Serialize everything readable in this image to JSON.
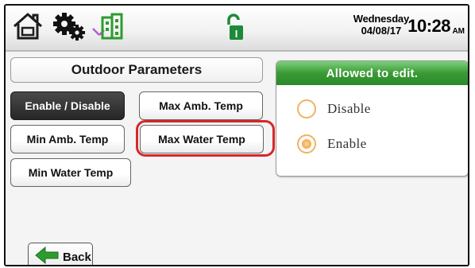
{
  "header": {
    "icons": [
      "home-icon",
      "settings-gears-icon",
      "building-network-icon",
      "unlocked-padlock-icon"
    ],
    "weekday": "Wednesday",
    "date": "04/08/17",
    "time": "10:28",
    "ampm": "AM"
  },
  "outdoor_parameters": {
    "title": "Outdoor Parameters",
    "buttons": [
      {
        "label": "Enable / Disable",
        "active": true
      },
      {
        "label": "Max Amb. Temp",
        "active": false
      },
      {
        "label": "Min Amb. Temp",
        "active": false
      },
      {
        "label": "Max Water Temp",
        "active": false,
        "highlighted": true
      },
      {
        "label": "Min Water Temp",
        "active": false
      }
    ],
    "highlight_color": "#d9262a"
  },
  "edit_panel": {
    "header": "Allowed to edit.",
    "header_color": "#3a9a35",
    "options": [
      {
        "label": "Disable",
        "selected": false
      },
      {
        "label": "Enable",
        "selected": true
      }
    ]
  },
  "back": {
    "label": "Back",
    "icon": "green-left-arrow-icon"
  }
}
